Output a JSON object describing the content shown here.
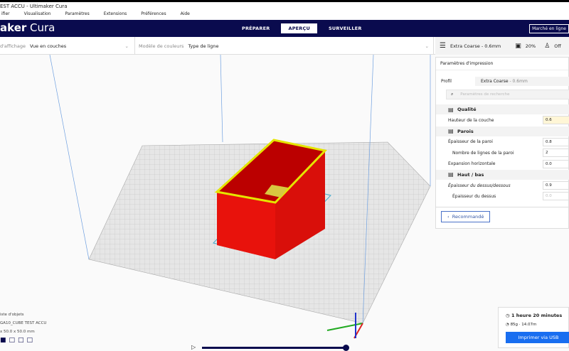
{
  "window": {
    "title": "EST ACCU - Ultimaker Cura"
  },
  "menu": [
    "ifier",
    "Visualisation",
    "Paramètres",
    "Extensions",
    "Préférences",
    "Aide"
  ],
  "header": {
    "logo_bold": "aker",
    "logo_light": " Cura",
    "tabs": [
      {
        "label": "PRÉPARER"
      },
      {
        "label": "APERÇU",
        "active": true
      },
      {
        "label": "SURVEILLER"
      }
    ],
    "market": "Marché en ligne"
  },
  "toolbar": {
    "view_label": "d'affichage",
    "view_value": "Vue en couches",
    "color_label": "Modèle de couleurs",
    "color_value": "Type de ligne",
    "profile": "Extra Coarse - 0.6mm",
    "infill": "20%",
    "support": "Off"
  },
  "panel": {
    "title": "Paramètres d'impression",
    "profile_label": "Profil",
    "profile_value": "Extra Coarse",
    "profile_suffix": " - 0.6mm",
    "search_placeholder": "Paramètres de recherche",
    "rows": [
      {
        "type": "section",
        "label": "Qualité"
      },
      {
        "label": "Hauteur de la couche",
        "value": "0.6",
        "highlight": true
      },
      {
        "type": "section",
        "label": "Parois"
      },
      {
        "label": "Épaisseur de la paroi",
        "value": "0.8"
      },
      {
        "label": "Nombre de lignes de la paroi",
        "value": "2",
        "indent": true
      },
      {
        "label": "Expansion horizontale",
        "value": "0.0"
      },
      {
        "type": "section",
        "label": "Haut / bas"
      },
      {
        "label": "Épaisseur du dessus/dessous",
        "value": "0.9",
        "italic": true
      },
      {
        "label": "Épaisseur du dessus",
        "value": "0.0",
        "indent": true,
        "disabled": true
      }
    ],
    "recommended": "Recommandé"
  },
  "objects": {
    "list_label": "iste d'objets",
    "name": "GA10_CUBE TEST ACCU",
    "dims": "x 50.0 x 50.0 mm"
  },
  "estimate": {
    "time": "1 heure 20 minutes",
    "material": "85g · 14.07m",
    "print_button": "Imprimer via USB"
  },
  "colors": {
    "header": "#0a0b4e",
    "accent": "#196ef0",
    "model": "#e8120c",
    "rim": "#e5e500"
  }
}
